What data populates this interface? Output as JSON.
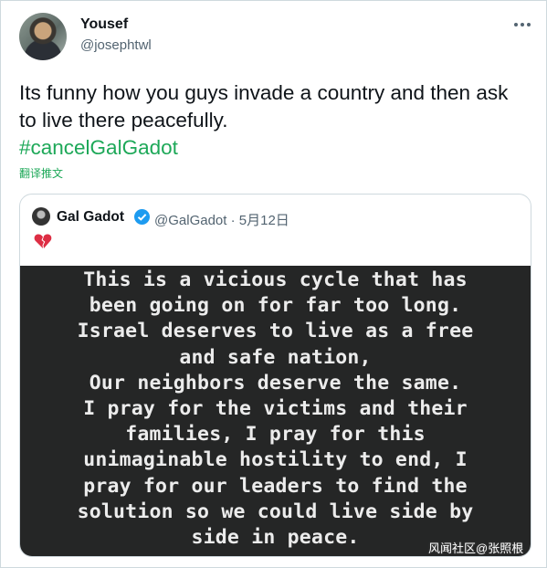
{
  "tweet": {
    "display_name": "Yousef",
    "handle": "@josephtwl",
    "text": "Its funny how you guys invade a country and then ask to live there peacefully.",
    "hashtag": "#cancelGalGadot",
    "translate_label": "翻译推文",
    "more_icon": "more-dots-icon"
  },
  "quoted": {
    "display_name": "Gal Gadot",
    "verified_icon": "verified-badge-icon",
    "meta": "@GalGadot · 5月12日",
    "emoji_icon": "broken-heart-icon",
    "story_lines": [
      "This is a vicious cycle that has",
      "been going on for far too long.",
      "Israel deserves to live as a free",
      "and safe nation,",
      "Our neighbors deserve the same.",
      "I pray for the victims and their",
      "families, I pray for this",
      "unimaginable hostility to end, I",
      "pray for our leaders to find the",
      "solution so we could live side by",
      "side in peace."
    ]
  },
  "watermark": "风闻社区@张照根",
  "colors": {
    "hashtag": "#1da858",
    "verified": "#1d9bf0",
    "story_bg": "#252626"
  }
}
